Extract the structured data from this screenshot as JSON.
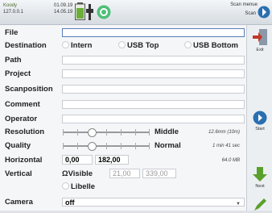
{
  "topbar": {
    "user": "Koody",
    "ip": "127.0.0.1",
    "date": "01.09.19",
    "time": "14.05.19",
    "scan_label": "Scan menue",
    "scan_button": "Scan"
  },
  "form": {
    "file": {
      "label": "File",
      "value": ""
    },
    "destination": {
      "label": "Destination",
      "options": [
        "Intern",
        "USB Top",
        "USB Bottom"
      ]
    },
    "path": {
      "label": "Path",
      "value": ""
    },
    "project": {
      "label": "Project",
      "value": ""
    },
    "scanposition": {
      "label": "Scanposition",
      "value": ""
    },
    "comment": {
      "label": "Comment",
      "value": ""
    },
    "operator": {
      "label": "Operator",
      "value": ""
    },
    "resolution": {
      "label": "Resolution",
      "value_text": "Middle",
      "info": "12.6mm (10m)",
      "level": 0.33
    },
    "quality": {
      "label": "Quality",
      "value_text": "Normal",
      "info": "1 min 41 sec",
      "level": 0.33
    },
    "horizontal": {
      "label": "Horizontal",
      "from": "0,00",
      "to": "182,00",
      "info": "64.0 MB"
    },
    "vertical": {
      "label": "Vertical",
      "mode": "Visible",
      "from": "21,00",
      "to": "339,00"
    },
    "libelle": {
      "label": "Libelle"
    },
    "camera": {
      "label": "Camera",
      "value": "off"
    }
  },
  "sidebar": {
    "exit": "Exit",
    "start": "Start",
    "next": "Next"
  },
  "colors": {
    "accent": "#2a6fb0",
    "green": "#5aa02c",
    "red": "#c0392b"
  }
}
